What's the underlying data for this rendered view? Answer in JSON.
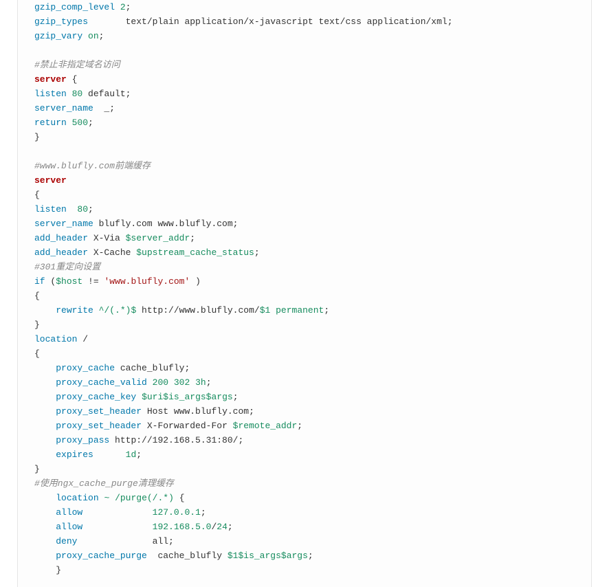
{
  "lines": [
    {
      "spans": [
        {
          "c": "kw",
          "t": "gzip_comp_level"
        },
        {
          "c": "",
          "t": " "
        },
        {
          "c": "num",
          "t": "2"
        },
        {
          "c": "",
          "t": ";"
        }
      ]
    },
    {
      "spans": [
        {
          "c": "kw",
          "t": "gzip_types"
        },
        {
          "c": "",
          "t": "       text/plain application/x-javascript text/css application/xml;"
        }
      ]
    },
    {
      "spans": [
        {
          "c": "kw",
          "t": "gzip_vary"
        },
        {
          "c": "",
          "t": " "
        },
        {
          "c": "on",
          "t": "on"
        },
        {
          "c": "",
          "t": ";"
        }
      ]
    },
    {
      "spans": [
        {
          "c": "",
          "t": ""
        }
      ]
    },
    {
      "spans": [
        {
          "c": "comment",
          "t": "#禁止非指定域名访问"
        }
      ]
    },
    {
      "spans": [
        {
          "c": "kw-bold",
          "t": "server"
        },
        {
          "c": "",
          "t": " {"
        }
      ]
    },
    {
      "spans": [
        {
          "c": "kw",
          "t": "listen"
        },
        {
          "c": "",
          "t": " "
        },
        {
          "c": "num",
          "t": "80"
        },
        {
          "c": "",
          "t": " default;"
        }
      ]
    },
    {
      "spans": [
        {
          "c": "kw",
          "t": "server_name"
        },
        {
          "c": "",
          "t": "  _;"
        }
      ]
    },
    {
      "spans": [
        {
          "c": "kw",
          "t": "return"
        },
        {
          "c": "",
          "t": " "
        },
        {
          "c": "num",
          "t": "500"
        },
        {
          "c": "",
          "t": ";"
        }
      ]
    },
    {
      "spans": [
        {
          "c": "",
          "t": "}"
        }
      ]
    },
    {
      "spans": [
        {
          "c": "",
          "t": ""
        }
      ]
    },
    {
      "spans": [
        {
          "c": "comment",
          "t": "#www.blufly.com前端缓存"
        }
      ]
    },
    {
      "spans": [
        {
          "c": "kw-bold",
          "t": "server"
        }
      ]
    },
    {
      "spans": [
        {
          "c": "",
          "t": "{"
        }
      ]
    },
    {
      "spans": [
        {
          "c": "kw",
          "t": "listen"
        },
        {
          "c": "",
          "t": "  "
        },
        {
          "c": "num",
          "t": "80"
        },
        {
          "c": "",
          "t": ";"
        }
      ]
    },
    {
      "spans": [
        {
          "c": "kw",
          "t": "server_name"
        },
        {
          "c": "",
          "t": " blufly.com www.blufly.com;"
        }
      ]
    },
    {
      "spans": [
        {
          "c": "kw",
          "t": "add_header"
        },
        {
          "c": "",
          "t": " X-Via "
        },
        {
          "c": "var",
          "t": "$server_addr"
        },
        {
          "c": "",
          "t": ";"
        }
      ]
    },
    {
      "spans": [
        {
          "c": "kw",
          "t": "add_header"
        },
        {
          "c": "",
          "t": " X-Cache "
        },
        {
          "c": "var",
          "t": "$upstream_cache_status"
        },
        {
          "c": "",
          "t": ";"
        }
      ]
    },
    {
      "spans": [
        {
          "c": "comment",
          "t": "#301重定向设置"
        }
      ]
    },
    {
      "spans": [
        {
          "c": "kw",
          "t": "if"
        },
        {
          "c": "",
          "t": " ("
        },
        {
          "c": "var",
          "t": "$host"
        },
        {
          "c": "",
          "t": " != "
        },
        {
          "c": "str",
          "t": "'www.blufly.com'"
        },
        {
          "c": "",
          "t": " )"
        }
      ]
    },
    {
      "spans": [
        {
          "c": "",
          "t": "{"
        }
      ]
    },
    {
      "spans": [
        {
          "c": "",
          "t": "    "
        },
        {
          "c": "kw",
          "t": "rewrite "
        },
        {
          "c": "regex",
          "t": "^/(.*)$"
        },
        {
          "c": "",
          "t": " http://www.blufly.com/"
        },
        {
          "c": "var",
          "t": "$1"
        },
        {
          "c": "",
          "t": " "
        },
        {
          "c": "perm",
          "t": "permanent"
        },
        {
          "c": "",
          "t": ";"
        }
      ]
    },
    {
      "spans": [
        {
          "c": "",
          "t": "}"
        }
      ]
    },
    {
      "spans": [
        {
          "c": "kw",
          "t": "location"
        },
        {
          "c": "",
          "t": " /"
        }
      ]
    },
    {
      "spans": [
        {
          "c": "",
          "t": "{"
        }
      ]
    },
    {
      "spans": [
        {
          "c": "",
          "t": "    "
        },
        {
          "c": "kw",
          "t": "proxy_cache"
        },
        {
          "c": "",
          "t": " cache_blufly;"
        }
      ]
    },
    {
      "spans": [
        {
          "c": "",
          "t": "    "
        },
        {
          "c": "kw",
          "t": "proxy_cache_valid"
        },
        {
          "c": "",
          "t": " "
        },
        {
          "c": "num",
          "t": "200"
        },
        {
          "c": "",
          "t": " "
        },
        {
          "c": "num",
          "t": "302"
        },
        {
          "c": "",
          "t": " "
        },
        {
          "c": "num",
          "t": "3h"
        },
        {
          "c": "",
          "t": ";"
        }
      ]
    },
    {
      "spans": [
        {
          "c": "",
          "t": "    "
        },
        {
          "c": "kw",
          "t": "proxy_cache_key"
        },
        {
          "c": "",
          "t": " "
        },
        {
          "c": "var",
          "t": "$uri$is_args$args"
        },
        {
          "c": "",
          "t": ";"
        }
      ]
    },
    {
      "spans": [
        {
          "c": "",
          "t": "    "
        },
        {
          "c": "kw",
          "t": "proxy_set_header"
        },
        {
          "c": "",
          "t": " Host www.blufly.com;"
        }
      ]
    },
    {
      "spans": [
        {
          "c": "",
          "t": "    "
        },
        {
          "c": "kw",
          "t": "proxy_set_header"
        },
        {
          "c": "",
          "t": " X-Forwarded-For "
        },
        {
          "c": "var",
          "t": "$remote_addr"
        },
        {
          "c": "",
          "t": ";"
        }
      ]
    },
    {
      "spans": [
        {
          "c": "",
          "t": "    "
        },
        {
          "c": "kw",
          "t": "proxy_pass"
        },
        {
          "c": "",
          "t": " http://192.168.5.31:80/;"
        }
      ]
    },
    {
      "spans": [
        {
          "c": "",
          "t": "    "
        },
        {
          "c": "kw",
          "t": "expires"
        },
        {
          "c": "",
          "t": "      "
        },
        {
          "c": "num",
          "t": "1d"
        },
        {
          "c": "",
          "t": ";"
        }
      ]
    },
    {
      "spans": [
        {
          "c": "",
          "t": "}"
        }
      ]
    },
    {
      "spans": [
        {
          "c": "comment",
          "t": "#使用ngx_cache_purge清理缓存"
        }
      ]
    },
    {
      "spans": [
        {
          "c": "",
          "t": "    "
        },
        {
          "c": "kw",
          "t": "location"
        },
        {
          "c": "",
          "t": " "
        },
        {
          "c": "regex",
          "t": "~"
        },
        {
          "c": "",
          "t": " "
        },
        {
          "c": "regex",
          "t": "/purge(/.*)"
        },
        {
          "c": "",
          "t": " {"
        }
      ]
    },
    {
      "spans": [
        {
          "c": "",
          "t": "    "
        },
        {
          "c": "kw",
          "t": "allow"
        },
        {
          "c": "",
          "t": "             "
        },
        {
          "c": "num",
          "t": "127.0.0.1"
        },
        {
          "c": "",
          "t": ";"
        }
      ]
    },
    {
      "spans": [
        {
          "c": "",
          "t": "    "
        },
        {
          "c": "kw",
          "t": "allow"
        },
        {
          "c": "",
          "t": "             "
        },
        {
          "c": "num",
          "t": "192.168.5.0"
        },
        {
          "c": "",
          "t": "/"
        },
        {
          "c": "num",
          "t": "24"
        },
        {
          "c": "",
          "t": ";"
        }
      ]
    },
    {
      "spans": [
        {
          "c": "",
          "t": "    "
        },
        {
          "c": "kw",
          "t": "deny"
        },
        {
          "c": "",
          "t": "              all;"
        }
      ]
    },
    {
      "spans": [
        {
          "c": "",
          "t": "    "
        },
        {
          "c": "kw",
          "t": "proxy_cache_purge"
        },
        {
          "c": "",
          "t": "  cache_blufly "
        },
        {
          "c": "var",
          "t": "$1$is_args$args"
        },
        {
          "c": "",
          "t": ";"
        }
      ]
    },
    {
      "spans": [
        {
          "c": "",
          "t": "    }"
        }
      ]
    }
  ]
}
